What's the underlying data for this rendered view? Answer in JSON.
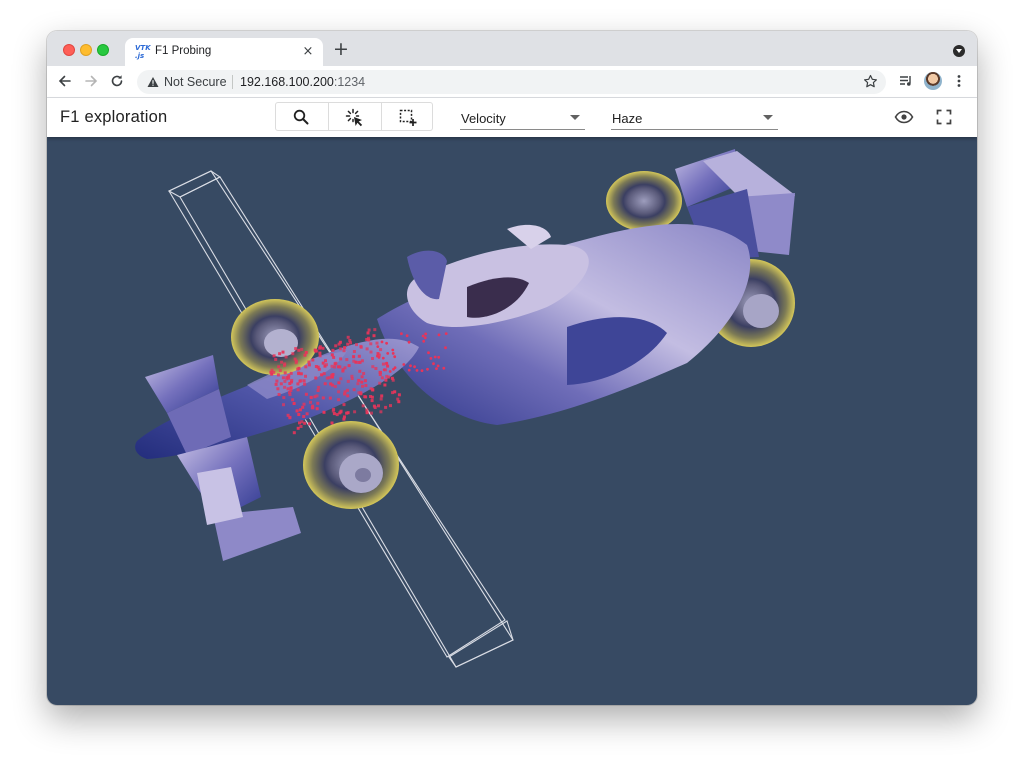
{
  "browser": {
    "tab": {
      "title": "F1 Probing",
      "favicon": "VTK .js"
    },
    "new_tab": "+",
    "close": "×",
    "address": {
      "security": "Not Secure",
      "host": "192.168.100.200",
      "port": ":1234"
    }
  },
  "app": {
    "title": "F1 exploration",
    "tools": [
      "search-icon",
      "pick-cursor-icon",
      "add-selection-icon"
    ],
    "field_select": {
      "value": "Velocity"
    },
    "preset_select": {
      "value": "Haze"
    },
    "right_icons": [
      "eye-icon",
      "fullscreen-icon"
    ]
  },
  "viewport": {
    "background": "#374a63",
    "model": "f1-car",
    "probe_points_color": "#e8345a"
  },
  "colors": {
    "tab_strip": "#dfe1e5",
    "car_body": "#b9b4dc",
    "car_dark": "#2a3380",
    "tire": "#e2d35a"
  }
}
